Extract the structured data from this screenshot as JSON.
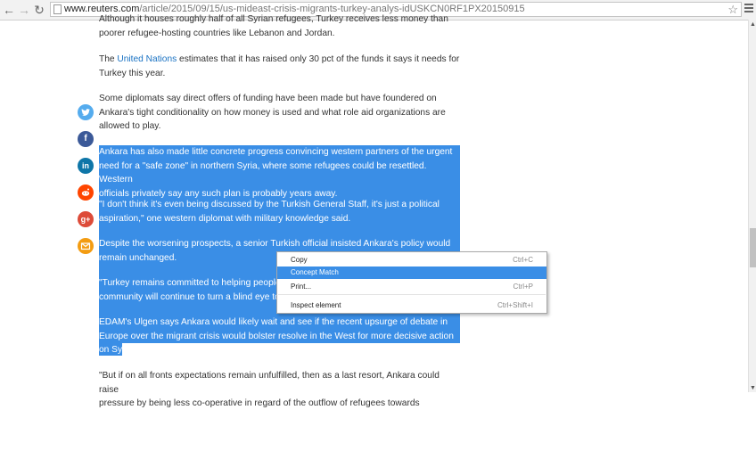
{
  "browser": {
    "back_icon": "arrow-left-icon",
    "forward_icon": "arrow-right-icon",
    "reload_icon": "reload-icon",
    "url_host": "www.reuters.com",
    "url_path": "/article/2015/09/15/us-mideast-crisis-migrants-turkey-analys-idUSKCN0RF1PX20150915"
  },
  "article": {
    "p0": "Although it houses roughly half of all Syrian refugees, Turkey receives less money than",
    "p0b": "poorer refugee-hosting countries like Lebanon and Jordan.",
    "p1_pre": "The ",
    "p1_link": "United Nations",
    "p1_post": " estimates that it has raised only 30 pct of the funds it says it needs for",
    "p1b": "Turkey this year.",
    "p2a": "Some diplomats say direct offers of funding have been made but have foundered on",
    "p2b": "Ankara's tight conditionality on how money is used and what role aid organizations are",
    "p2c": "allowed to play.",
    "p3a": "Ankara has also made little concrete progress convincing western partners of the urgent",
    "p3b": "need for a \"safe zone\" in northern Syria, where some refugees could be resettled. Western",
    "p3c": "officials privately say any such plan is probably years away.",
    "p4a": "\"I don't think it's even being discussed by the Turkish General Staff, it's just a political",
    "p4b": "aspiration,\" one western diplomat with military knowledge said.",
    "p5a": "Despite the worsening prospects, a senior Turkish official insisted Ankara's policy would",
    "p5b": "remain unchanged.",
    "p6a": "\"Turkey remains committed to helping people",
    "p6b": "community will continue to turn a blind eye to",
    "p7a": "EDAM's Ulgen says Ankara would likely wait and see if the recent upsurge of debate in",
    "p7b": "Europe over the migrant crisis would bolster resolve in the West for more decisive action",
    "p7c": "on Syria.",
    "p8a": "\"But if on all fronts expectations remain unfulfilled, then as a last resort, Ankara could raise",
    "p8b": "pressure by being less co-operative in regard of the outflow of refugees towards"
  },
  "share": {
    "twitter": "twitter-icon",
    "facebook": "facebook-icon",
    "linkedin": "linkedin-icon",
    "reddit": "reddit-icon",
    "googleplus": "google-plus-icon",
    "email": "email-icon",
    "facebook_glyph": "f",
    "linkedin_glyph": "in",
    "googleplus_glyph": "g+"
  },
  "context_menu": {
    "items": [
      {
        "label": "Copy",
        "shortcut": "Ctrl+C"
      },
      {
        "label": "Concept Match",
        "shortcut": ""
      },
      {
        "label": "Print...",
        "shortcut": "Ctrl+P"
      },
      {
        "label": "Inspect element",
        "shortcut": "Ctrl+Shift+I"
      }
    ]
  },
  "colors": {
    "selection": "#3a8ee6",
    "link": "#1a72c3",
    "twitter": "#55acee",
    "facebook": "#3b5998",
    "linkedin": "#0e76a8",
    "reddit": "#ff4500",
    "googleplus": "#dd4b39",
    "email": "#f39c12"
  }
}
